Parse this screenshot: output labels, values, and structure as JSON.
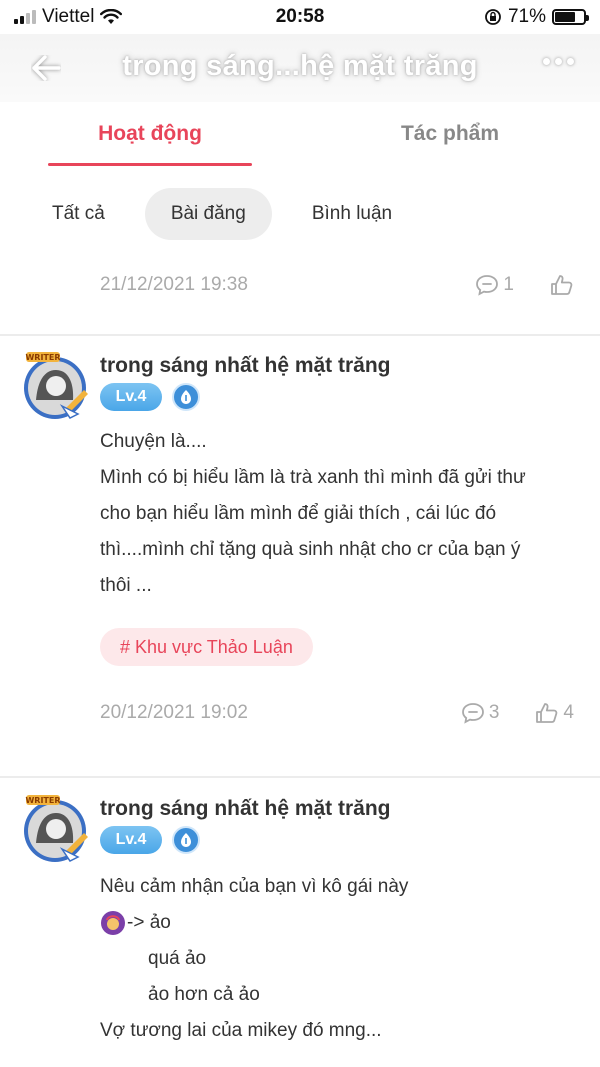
{
  "status_bar": {
    "carrier": "Viettel",
    "time": "20:58",
    "battery": "71%",
    "battery_level": 0.71
  },
  "header": {
    "title": "trong sáng...hệ mặt trăng",
    "back_icon": "arrow-left-icon",
    "more_icon": "more-dots-icon"
  },
  "tabs": [
    {
      "label": "Hoạt động",
      "active": true
    },
    {
      "label": "Tác phẩm",
      "active": false
    }
  ],
  "filters": [
    {
      "label": "Tất cả",
      "active": false
    },
    {
      "label": "Bài đăng",
      "active": true
    },
    {
      "label": "Bình luận",
      "active": false
    }
  ],
  "top_meta": {
    "date": "21/12/2021 19:38",
    "comments": "1",
    "likes": ""
  },
  "posts": [
    {
      "author": "trong sáng nhất hệ mặt trăng",
      "level": "Lv.4",
      "lines": [
        "Chuyện là....",
        "Mình có bị hiểu lầm là trà xanh thì mình đã gửi thư",
        "cho bạn hiểu lầm mình để giải thích , cái lúc đó",
        "thì....mình chỉ tặng quà sinh nhật cho cr của bạn ý",
        "thôi ..."
      ],
      "tag": "# Khu vực Thảo Luận",
      "date": "20/12/2021 19:02",
      "comments": "3",
      "likes": "4"
    },
    {
      "author": "trong sáng nhất hệ mặt trăng",
      "level": "Lv.4",
      "lines": [
        "Nêu cảm nhận của bạn vì kô gái này",
        "-> ảo",
        "quá ảo",
        "ảo hơn cả ảo",
        "Vợ tương lai của mikey đó mng..."
      ]
    }
  ],
  "colors": {
    "accent": "#e8455a",
    "level_badge": "#4aa6e8",
    "muted_text": "#aaaaaa"
  }
}
